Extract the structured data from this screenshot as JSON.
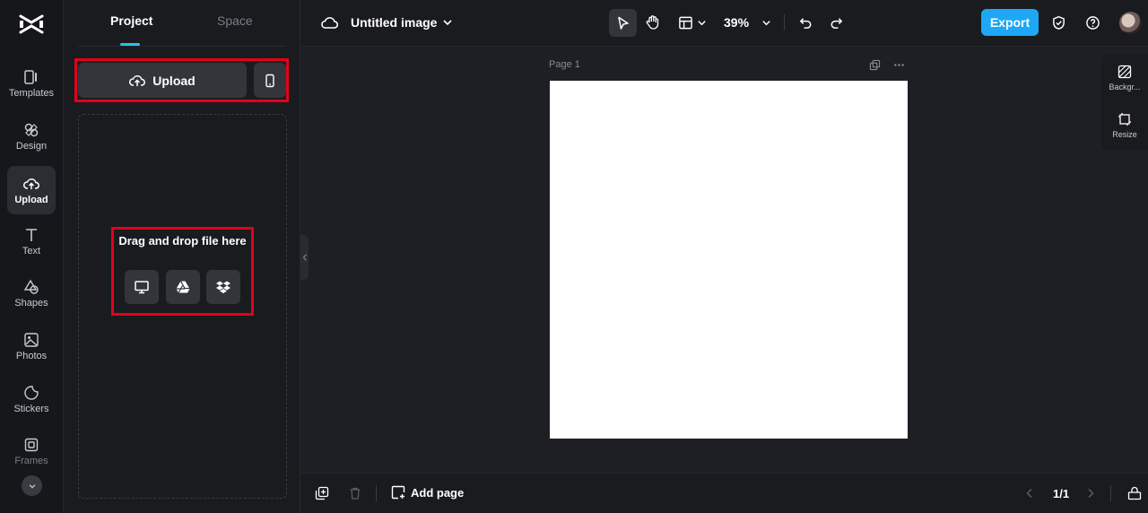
{
  "rail": {
    "items": [
      {
        "label": "Templates",
        "icon": "templates-icon"
      },
      {
        "label": "Design",
        "icon": "design-icon"
      },
      {
        "label": "Upload",
        "icon": "upload-cloud-icon"
      },
      {
        "label": "Text",
        "icon": "text-icon"
      },
      {
        "label": "Shapes",
        "icon": "shapes-icon"
      },
      {
        "label": "Photos",
        "icon": "photos-icon"
      },
      {
        "label": "Stickers",
        "icon": "stickers-icon"
      },
      {
        "label": "Frames",
        "icon": "frames-icon"
      }
    ]
  },
  "panel": {
    "tabs": [
      {
        "label": "Project"
      },
      {
        "label": "Space"
      }
    ],
    "upload_label": "Upload",
    "dropzone_text": "Drag and drop file here",
    "sources": [
      "computer-icon",
      "google-drive-icon",
      "dropbox-icon"
    ]
  },
  "topbar": {
    "title": "Untitled image",
    "zoom": "39%",
    "export_label": "Export"
  },
  "canvas": {
    "page_label": "Page 1"
  },
  "side_tools": [
    {
      "label": "Backgr..."
    },
    {
      "label": "Resize"
    }
  ],
  "bottombar": {
    "add_page_label": "Add page",
    "pager": "1/1"
  },
  "colors": {
    "accent": "#27c3e0",
    "export": "#1ea7f5",
    "highlight": "#e3001b",
    "canvas": "#ffffff"
  }
}
